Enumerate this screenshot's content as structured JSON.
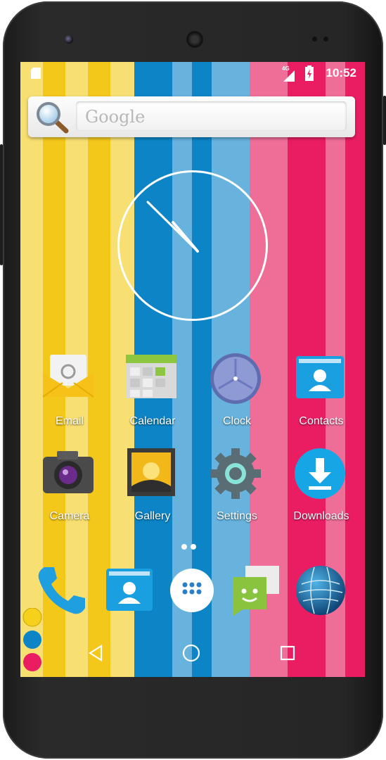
{
  "status_bar": {
    "time": "10:52",
    "network": "4G"
  },
  "search": {
    "placeholder": "Google"
  },
  "apps": [
    {
      "label": "Email",
      "icon": "email-icon"
    },
    {
      "label": "Calendar",
      "icon": "calendar-icon"
    },
    {
      "label": "Clock",
      "icon": "clock-icon"
    },
    {
      "label": "Contacts",
      "icon": "contacts-icon"
    },
    {
      "label": "Camera",
      "icon": "camera-icon"
    },
    {
      "label": "Gallery",
      "icon": "gallery-icon"
    },
    {
      "label": "Settings",
      "icon": "settings-icon"
    },
    {
      "label": "Downloads",
      "icon": "downloads-icon"
    }
  ],
  "dock": [
    "phone-icon",
    "contacts-icon",
    "app-drawer-icon",
    "messaging-icon",
    "browser-globe-icon"
  ],
  "colors": {
    "yellow": "#f6d11c",
    "blue": "#0c84c6",
    "pink": "#ea1d63"
  }
}
